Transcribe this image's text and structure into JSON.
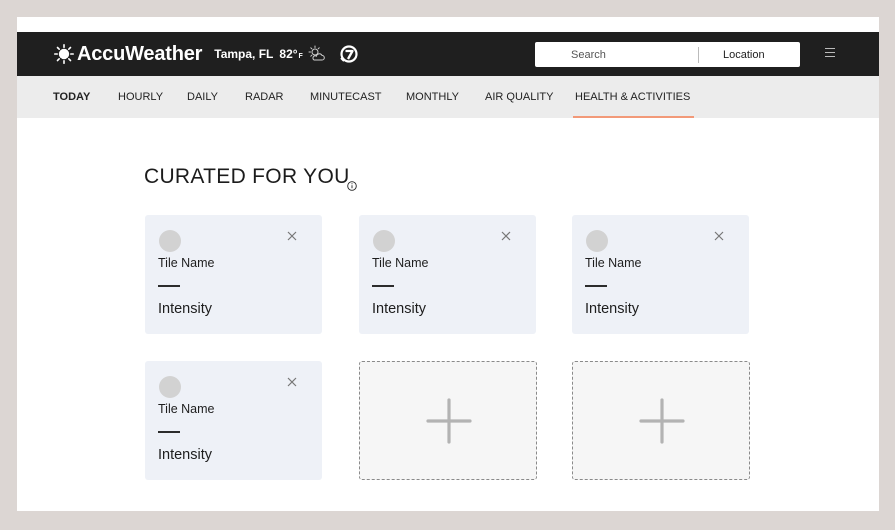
{
  "header": {
    "brand": "AccuWeather",
    "city": "Tampa, FL",
    "temperature": "82°",
    "unit": "F",
    "weather_icon": "partly-sunny-icon",
    "partner_icon": "abc-7-logo",
    "search": {
      "placeholder": "Search"
    },
    "location_label": "Location",
    "menu_icon": "hamburger-menu-icon"
  },
  "nav": {
    "items": [
      {
        "label": "TODAY"
      },
      {
        "label": "HOURLY"
      },
      {
        "label": "DAILY"
      },
      {
        "label": "RADAR"
      },
      {
        "label": "MINUTECAST"
      },
      {
        "label": "MONTHLY"
      },
      {
        "label": "AIR QUALITY"
      },
      {
        "label": "HEALTH & ACTIVITIES"
      }
    ],
    "active": "HEALTH & ACTIVITIES",
    "active_color": "#f29978"
  },
  "main": {
    "title": "CURATED FOR YOU",
    "info_icon": "info-icon",
    "tiles": [
      {
        "name": "Tile Name",
        "intensity": "Intensity"
      },
      {
        "name": "Tile Name",
        "intensity": "Intensity"
      },
      {
        "name": "Tile Name",
        "intensity": "Intensity"
      },
      {
        "name": "Tile Name",
        "intensity": "Intensity"
      }
    ],
    "add_tiles": [
      {
        "icon": "plus-icon"
      },
      {
        "icon": "plus-icon"
      }
    ]
  },
  "colors": {
    "header_bg": "#1f1f1f",
    "nav_bg": "#ececec",
    "tile_bg": "#eef1f7",
    "page_bg": "#dcd6d3"
  }
}
